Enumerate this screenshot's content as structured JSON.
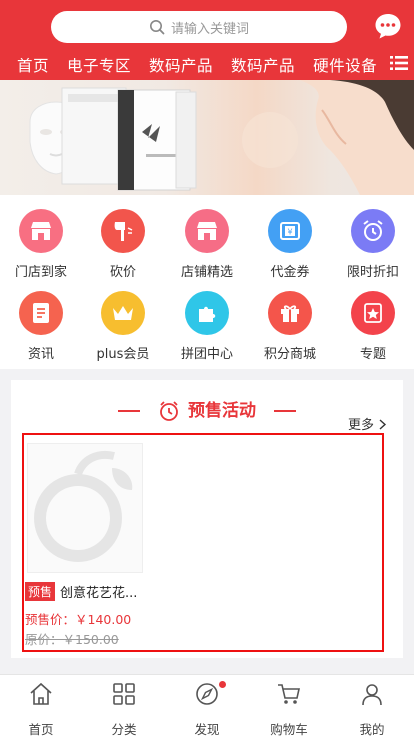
{
  "search": {
    "placeholder": "请输入关键词"
  },
  "nav": {
    "tabs": [
      "首页",
      "电子专区",
      "数码产品",
      "数码产品",
      "硬件设备"
    ]
  },
  "categories": [
    {
      "label": "门店到家",
      "icon": "store-icon",
      "color": "#f86f82"
    },
    {
      "label": "砍价",
      "icon": "axe-icon",
      "color": "#f2554c"
    },
    {
      "label": "店铺精选",
      "icon": "shop-icon",
      "color": "#f66d86"
    },
    {
      "label": "代金券",
      "icon": "coupon-icon",
      "color": "#43a0f4"
    },
    {
      "label": "限时折扣",
      "icon": "alarm-clock-icon",
      "color": "#7b7bf5"
    },
    {
      "label": "资讯",
      "icon": "news-icon",
      "color": "#f5634f"
    },
    {
      "label": "plus会员",
      "icon": "crown-icon",
      "color": "#f7be2f"
    },
    {
      "label": "拼团中心",
      "icon": "puzzle-icon",
      "color": "#2fc6e8"
    },
    {
      "label": "积分商城",
      "icon": "gift-icon",
      "color": "#f4554b"
    },
    {
      "label": "专题",
      "icon": "star-tag-icon",
      "color": "#f3434b"
    }
  ],
  "presale": {
    "title": "预售活动",
    "more": "更多",
    "product": {
      "tag": "预售",
      "name": "创意花艺花...",
      "price_label": "预售价：￥140.00",
      "orig_label": "原价：￥150.00"
    }
  },
  "tabbar": [
    {
      "label": "首页",
      "icon": "home-icon"
    },
    {
      "label": "分类",
      "icon": "category-icon"
    },
    {
      "label": "发现",
      "icon": "compass-icon"
    },
    {
      "label": "购物车",
      "icon": "cart-icon"
    },
    {
      "label": "我的",
      "icon": "user-icon"
    }
  ],
  "colors": {
    "brand": "#e8363a"
  }
}
